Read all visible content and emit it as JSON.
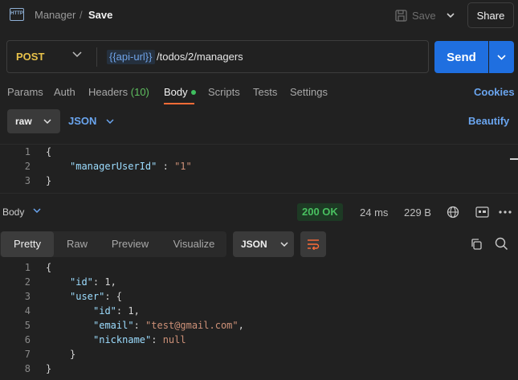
{
  "header": {
    "icon_text": "HTTP",
    "breadcrumb_parent": "Manager",
    "breadcrumb_separator": "/",
    "breadcrumb_current": "Save",
    "save_label": "Save",
    "share_label": "Share"
  },
  "request": {
    "method": "POST",
    "url_variable": "{{api-url}}",
    "url_path": "/todos/2/managers",
    "send_label": "Send"
  },
  "tabs": {
    "params": "Params",
    "auth": "Auth",
    "headers": "Headers",
    "headers_count": "(10)",
    "body": "Body",
    "scripts": "Scripts",
    "tests": "Tests",
    "settings": "Settings",
    "cookies": "Cookies"
  },
  "body_toolbar": {
    "mode": "raw",
    "format": "JSON",
    "beautify": "Beautify"
  },
  "request_body": {
    "lines": [
      "1",
      "2",
      "3"
    ],
    "open_brace": "{",
    "key": "\"managerUserId\"",
    "colon": " : ",
    "value": "\"1\"",
    "close_brace": "}"
  },
  "response": {
    "section_label": "Body",
    "status": "200 OK",
    "time": "24 ms",
    "size": "229 B",
    "views": [
      "Pretty",
      "Raw",
      "Preview",
      "Visualize"
    ],
    "format": "JSON",
    "lines": [
      "1",
      "2",
      "3",
      "4",
      "5",
      "6",
      "7",
      "8"
    ],
    "l1": "{",
    "id_key": "\"id\"",
    "id_val": "1",
    "user_key": "\"user\"",
    "inner_id_key": "\"id\"",
    "inner_id_val": "1",
    "email_key": "\"email\"",
    "email_val": "\"test@gmail.com\"",
    "nickname_key": "\"nickname\"",
    "nickname_val": "null",
    "close_inner": "}",
    "close_outer": "}"
  },
  "colors": {
    "method": "#e8c24a",
    "send": "#1f6fe0",
    "link": "#6aa5ef",
    "status": "#49c060",
    "tab_underline": "#ff6c37",
    "json_key": "#9cdcfe",
    "json_string": "#ce9178"
  }
}
